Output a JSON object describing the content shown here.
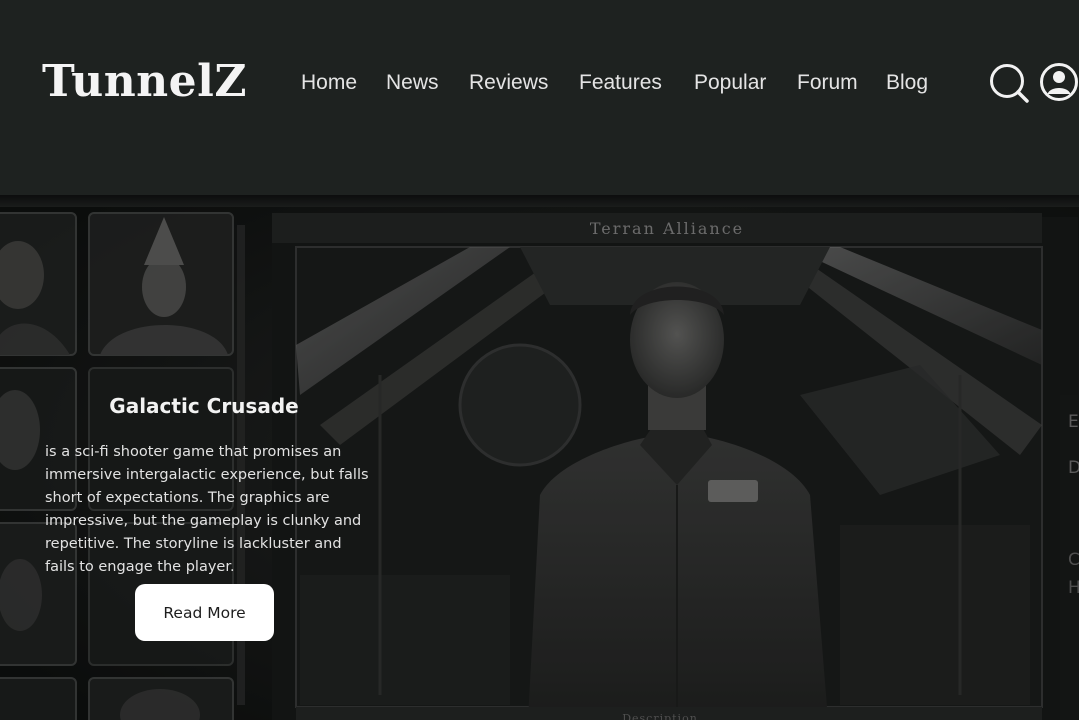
{
  "header": {
    "logo_text": "TunnelZ",
    "nav": [
      {
        "label": "Home"
      },
      {
        "label": "News"
      },
      {
        "label": "Reviews"
      },
      {
        "label": "Features"
      },
      {
        "label": "Popular"
      },
      {
        "label": "Forum"
      },
      {
        "label": "Blog"
      }
    ],
    "icons": [
      "search-icon",
      "user-account-icon"
    ]
  },
  "hero": {
    "banner_text": "Terran Alliance",
    "footer_text": "Description",
    "side_panel_letters": [
      "E",
      "D",
      "C",
      "H"
    ],
    "review": {
      "title": "Galactic Crusade",
      "body": "is a sci-fi shooter game that promises an immersive intergalactic experience, but falls short of expectations. The graphics are impressive, but the gameplay is clunky and repetitive. The storyline is lackluster and fails to engage the player.",
      "button_label": "Read More"
    }
  },
  "colors": {
    "header_bg": "#1e2220",
    "hero_bg": "#141615",
    "text": "#ffffff",
    "button_bg": "#ffffff",
    "button_text": "#1d1d1d"
  }
}
